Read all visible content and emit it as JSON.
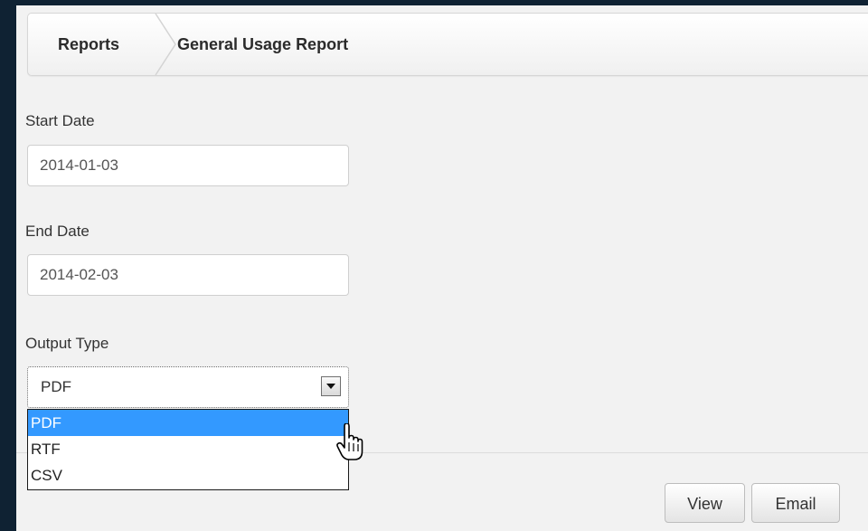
{
  "breadcrumb": {
    "items": [
      {
        "label": "Reports"
      },
      {
        "label": "General Usage Report"
      }
    ]
  },
  "form": {
    "start_date": {
      "label": "Start Date",
      "value": "2014-01-03"
    },
    "end_date": {
      "label": "End Date",
      "value": "2014-02-03"
    },
    "output_type": {
      "label": "Output Type",
      "selected": "PDF",
      "options": [
        "PDF",
        "RTF",
        "CSV"
      ],
      "highlighted_option": "PDF"
    }
  },
  "actions": {
    "view_label": "View",
    "email_label": "Email"
  },
  "colors": {
    "page_background": "#f2f2f2",
    "frame": "#0f2233",
    "highlight": "#3399ff"
  },
  "icons": {
    "select_arrow": "triangle-down-icon",
    "cursor": "hand-pointer-icon"
  }
}
